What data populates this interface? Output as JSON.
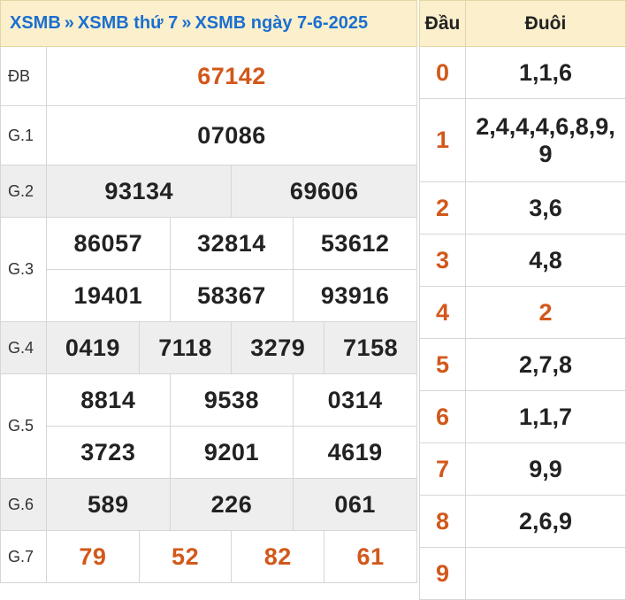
{
  "breadcrumb": {
    "part1": "XSMB",
    "sep1": "»",
    "part2": "XSMB thứ 7",
    "sep2": "»",
    "part3": "XSMB ngày 7-6-2025"
  },
  "prizes": {
    "db": {
      "label": "ĐB",
      "numbers": [
        "67142"
      ]
    },
    "g1": {
      "label": "G.1",
      "numbers": [
        "07086"
      ]
    },
    "g2": {
      "label": "G.2",
      "numbers": [
        "93134",
        "69606"
      ]
    },
    "g3": {
      "label": "G.3",
      "numbers": [
        "86057",
        "32814",
        "53612",
        "19401",
        "58367",
        "93916"
      ]
    },
    "g4": {
      "label": "G.4",
      "numbers": [
        "0419",
        "7118",
        "3279",
        "7158"
      ]
    },
    "g5": {
      "label": "G.5",
      "numbers": [
        "8814",
        "9538",
        "0314",
        "3723",
        "9201",
        "4619"
      ]
    },
    "g6": {
      "label": "G.6",
      "numbers": [
        "589",
        "226",
        "061"
      ]
    },
    "g7": {
      "label": "G.7",
      "numbers": [
        "79",
        "52",
        "82",
        "61"
      ]
    }
  },
  "loto": {
    "head_label": "Đầu",
    "tail_label": "Đuôi",
    "rows": [
      {
        "head": "0",
        "tail": "1,1,6"
      },
      {
        "head": "1",
        "tail": "2,4,4,4,6,8,9,9"
      },
      {
        "head": "2",
        "tail": "3,6"
      },
      {
        "head": "3",
        "tail": "4,8"
      },
      {
        "head": "4",
        "tail": "2"
      },
      {
        "head": "5",
        "tail": "2,7,8"
      },
      {
        "head": "6",
        "tail": "1,1,7"
      },
      {
        "head": "7",
        "tail": "9,9"
      },
      {
        "head": "8",
        "tail": "2,6,9"
      },
      {
        "head": "9",
        "tail": ""
      }
    ]
  },
  "colors": {
    "accent_orange": "#d2581a",
    "header_bg": "#fbefcc",
    "link_blue": "#1b6fd0",
    "stripe_gray": "#eeeeee"
  }
}
